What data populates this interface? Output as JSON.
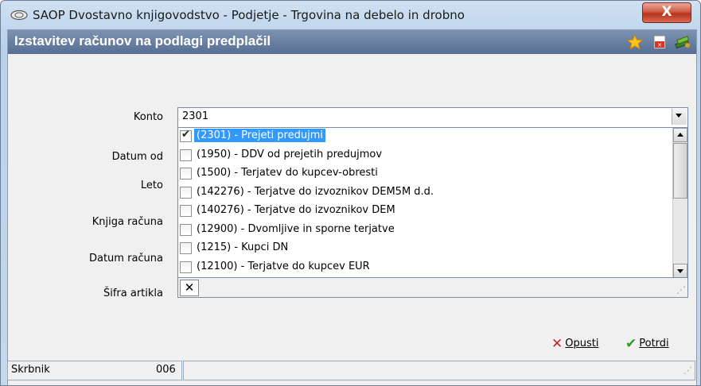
{
  "window": {
    "title": "SAOP Dvostavno knjigovodstvo - Podjetje - Trgovina na debelo in drobno",
    "close_label": "X"
  },
  "panel": {
    "title": "Izstavitev računov na podlagi predplačil",
    "icons": [
      "star-icon",
      "pdf-icon",
      "books-icon"
    ]
  },
  "form": {
    "labels": {
      "konto": "Konto",
      "datum_od": "Datum od",
      "leto": "Leto",
      "knjiga_racuna": "Knjiga računa",
      "datum_racuna": "Datum računa",
      "sifra_artikla": "Šifra artikla"
    },
    "konto_value": "2301",
    "sifra_artikla_clear": "✕"
  },
  "dropdown": {
    "items": [
      {
        "label": "(2301) - Prejeti predujmi",
        "checked": true,
        "selected": true
      },
      {
        "label": "(1950) - DDV od prejetih predujmov",
        "checked": false,
        "selected": false
      },
      {
        "label": "(1500) - Terjatev do kupcev-obresti",
        "checked": false,
        "selected": false
      },
      {
        "label": "(142276) - Terjatve do izvoznikov DEM5M d.d.",
        "checked": false,
        "selected": false
      },
      {
        "label": "(140276) - Terjatve do izvoznikov DEM",
        "checked": false,
        "selected": false
      },
      {
        "label": "(12900) - Dvomljive in sporne terjatve",
        "checked": false,
        "selected": false
      },
      {
        "label": "(1215) - Kupci DN",
        "checked": false,
        "selected": false
      },
      {
        "label": "(12100) - Terjatve do kupcev EUR",
        "checked": false,
        "selected": false
      }
    ]
  },
  "actions": {
    "cancel_label": "Opusti",
    "confirm_label": "Potrdi"
  },
  "status": {
    "label": "Skrbnik",
    "value": "006"
  },
  "colors": {
    "selection": "#3399ff",
    "panel_header": "#6a82a6",
    "cancel_icon": "#c0281b",
    "confirm_icon": "#2a9a2a"
  }
}
